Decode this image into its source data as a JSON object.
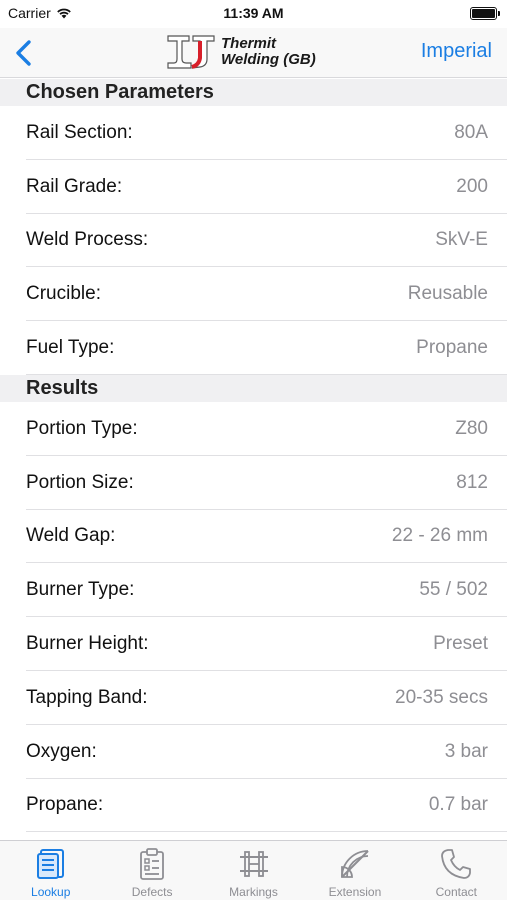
{
  "status_bar": {
    "carrier": "Carrier",
    "time": "11:39 AM"
  },
  "nav": {
    "logo_line1": "Thermit",
    "logo_line2": "Welding (GB)",
    "right_button": "Imperial"
  },
  "sections": [
    {
      "title": "Chosen Parameters",
      "rows": [
        {
          "label": "Rail Section:",
          "value": "80A"
        },
        {
          "label": "Rail Grade:",
          "value": "200"
        },
        {
          "label": "Weld Process:",
          "value": "SkV-E"
        },
        {
          "label": "Crucible:",
          "value": "Reusable"
        },
        {
          "label": "Fuel Type:",
          "value": "Propane"
        }
      ]
    },
    {
      "title": "Results",
      "rows": [
        {
          "label": "Portion Type:",
          "value": "Z80"
        },
        {
          "label": "Portion Size:",
          "value": "812"
        },
        {
          "label": "Weld Gap:",
          "value": "22 - 26 mm"
        },
        {
          "label": "Burner Type:",
          "value": "55 / 502"
        },
        {
          "label": "Burner Height:",
          "value": "Preset"
        },
        {
          "label": "Tapping Band:",
          "value": "20-35 secs"
        },
        {
          "label": "Oxygen:",
          "value": "3 bar"
        },
        {
          "label": "Propane:",
          "value": "0.7 bar"
        }
      ]
    }
  ],
  "tabs": [
    {
      "label": "Lookup",
      "icon": "lookup-icon",
      "active": true
    },
    {
      "label": "Defects",
      "icon": "defects-icon",
      "active": false
    },
    {
      "label": "Markings",
      "icon": "markings-icon",
      "active": false
    },
    {
      "label": "Extension",
      "icon": "extension-icon",
      "active": false
    },
    {
      "label": "Contact",
      "icon": "phone-icon",
      "active": false
    }
  ],
  "colors": {
    "accent": "#1b7ee3",
    "value_gray": "#8e8e93",
    "logo_red": "#d81f2a"
  }
}
